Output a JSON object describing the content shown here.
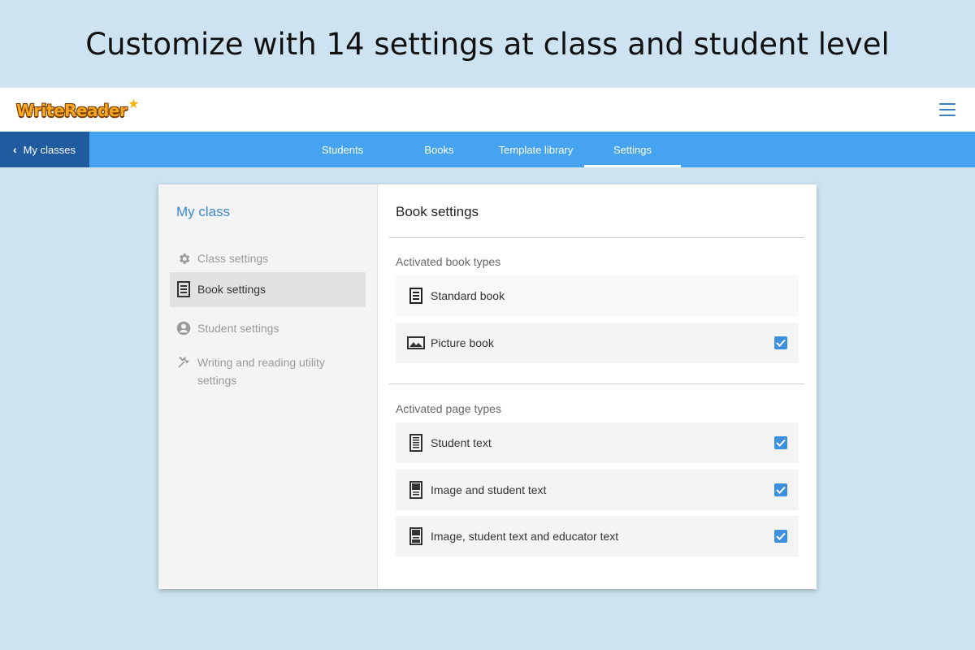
{
  "headline": "Customize with 14 settings at class and student level",
  "app": {
    "logo_text": "WriteReader"
  },
  "nav": {
    "back_label": "My classes",
    "tabs": [
      {
        "label": "Students"
      },
      {
        "label": "Books"
      },
      {
        "label": "Template library"
      },
      {
        "label": "Settings",
        "active": true
      }
    ]
  },
  "sidebar": {
    "title": "My class",
    "items": [
      {
        "label": "Class settings",
        "icon": "gear-icon"
      },
      {
        "label": "Book settings",
        "icon": "book-icon",
        "active": true
      },
      {
        "label": "Student settings",
        "icon": "user-icon"
      },
      {
        "label": "Writing and reading utility settings",
        "icon": "tools-icon"
      }
    ]
  },
  "content": {
    "title": "Book settings",
    "book_types": {
      "label": "Activated book types",
      "options": [
        {
          "label": "Standard book",
          "icon": "standard-book-icon",
          "checked": false
        },
        {
          "label": "Picture book",
          "icon": "picture-icon",
          "checked": true
        }
      ]
    },
    "page_types": {
      "label": "Activated page types",
      "options": [
        {
          "label": "Student text",
          "icon": "text-page-icon",
          "checked": true
        },
        {
          "label": "Image and student text",
          "icon": "image-text-page-icon",
          "checked": true
        },
        {
          "label": "Image, student text and educator text",
          "icon": "image-educator-page-icon",
          "checked": true
        }
      ]
    }
  },
  "colors": {
    "background": "#cde3f1",
    "navbar": "#45a3ef",
    "back_button": "#1f5b9e",
    "accent": "#3b88d0",
    "checkbox": "#3d8fe0"
  }
}
